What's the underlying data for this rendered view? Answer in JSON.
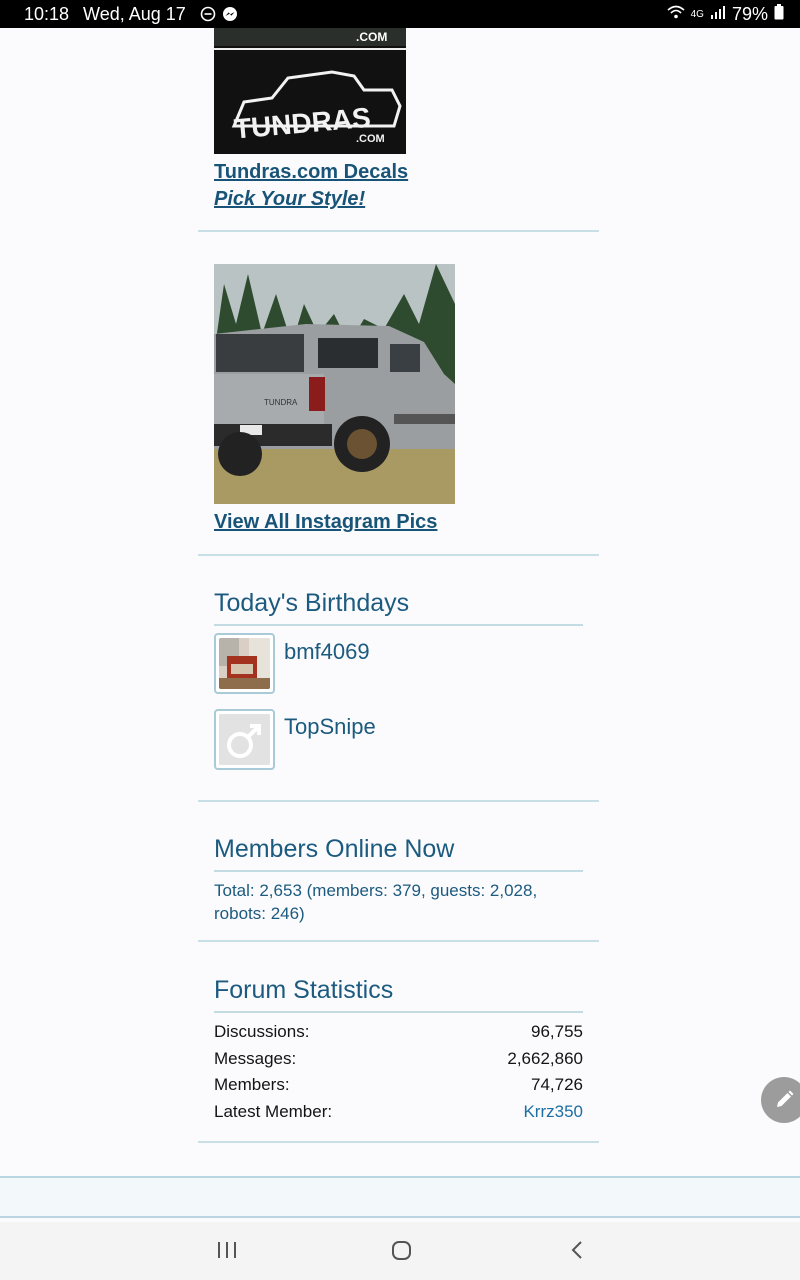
{
  "status_bar": {
    "time": "10:18",
    "date": "Wed, Aug 17",
    "battery": "79%",
    "network": "4G",
    "icons": [
      "do-not-disturb-icon",
      "messenger-icon",
      "wifi-icon",
      "signal-icon",
      "battery-icon"
    ]
  },
  "decals": {
    "image_text": "TUNDRAS",
    "image_subtext": ".COM",
    "link1": "Tundras.com Decals",
    "link2": "Pick Your Style!"
  },
  "instagram": {
    "truck_badge": "TUNDRA",
    "link": "View All Instagram Pics"
  },
  "birthdays": {
    "title": "Today's Birthdays",
    "members": [
      {
        "name": "bmf4069"
      },
      {
        "name": "TopSnipe"
      }
    ]
  },
  "online": {
    "title": "Members Online Now",
    "line1": "Total: 2,653 (members: 379, guests: 2,028,",
    "line2": "robots: 246)"
  },
  "stats": {
    "title": "Forum Statistics",
    "rows": [
      {
        "label": "Discussions:",
        "value": "96,755"
      },
      {
        "label": "Messages:",
        "value": "2,662,860"
      },
      {
        "label": "Members:",
        "value": "74,726"
      },
      {
        "label": "Latest Member:",
        "value": "Krrz350"
      }
    ]
  },
  "colors": {
    "accent": "#1c5a7f",
    "link": "#185478",
    "divider": "#c9dfe6"
  },
  "nav": {
    "icons": [
      "recents-icon",
      "home-icon",
      "back-icon"
    ]
  }
}
